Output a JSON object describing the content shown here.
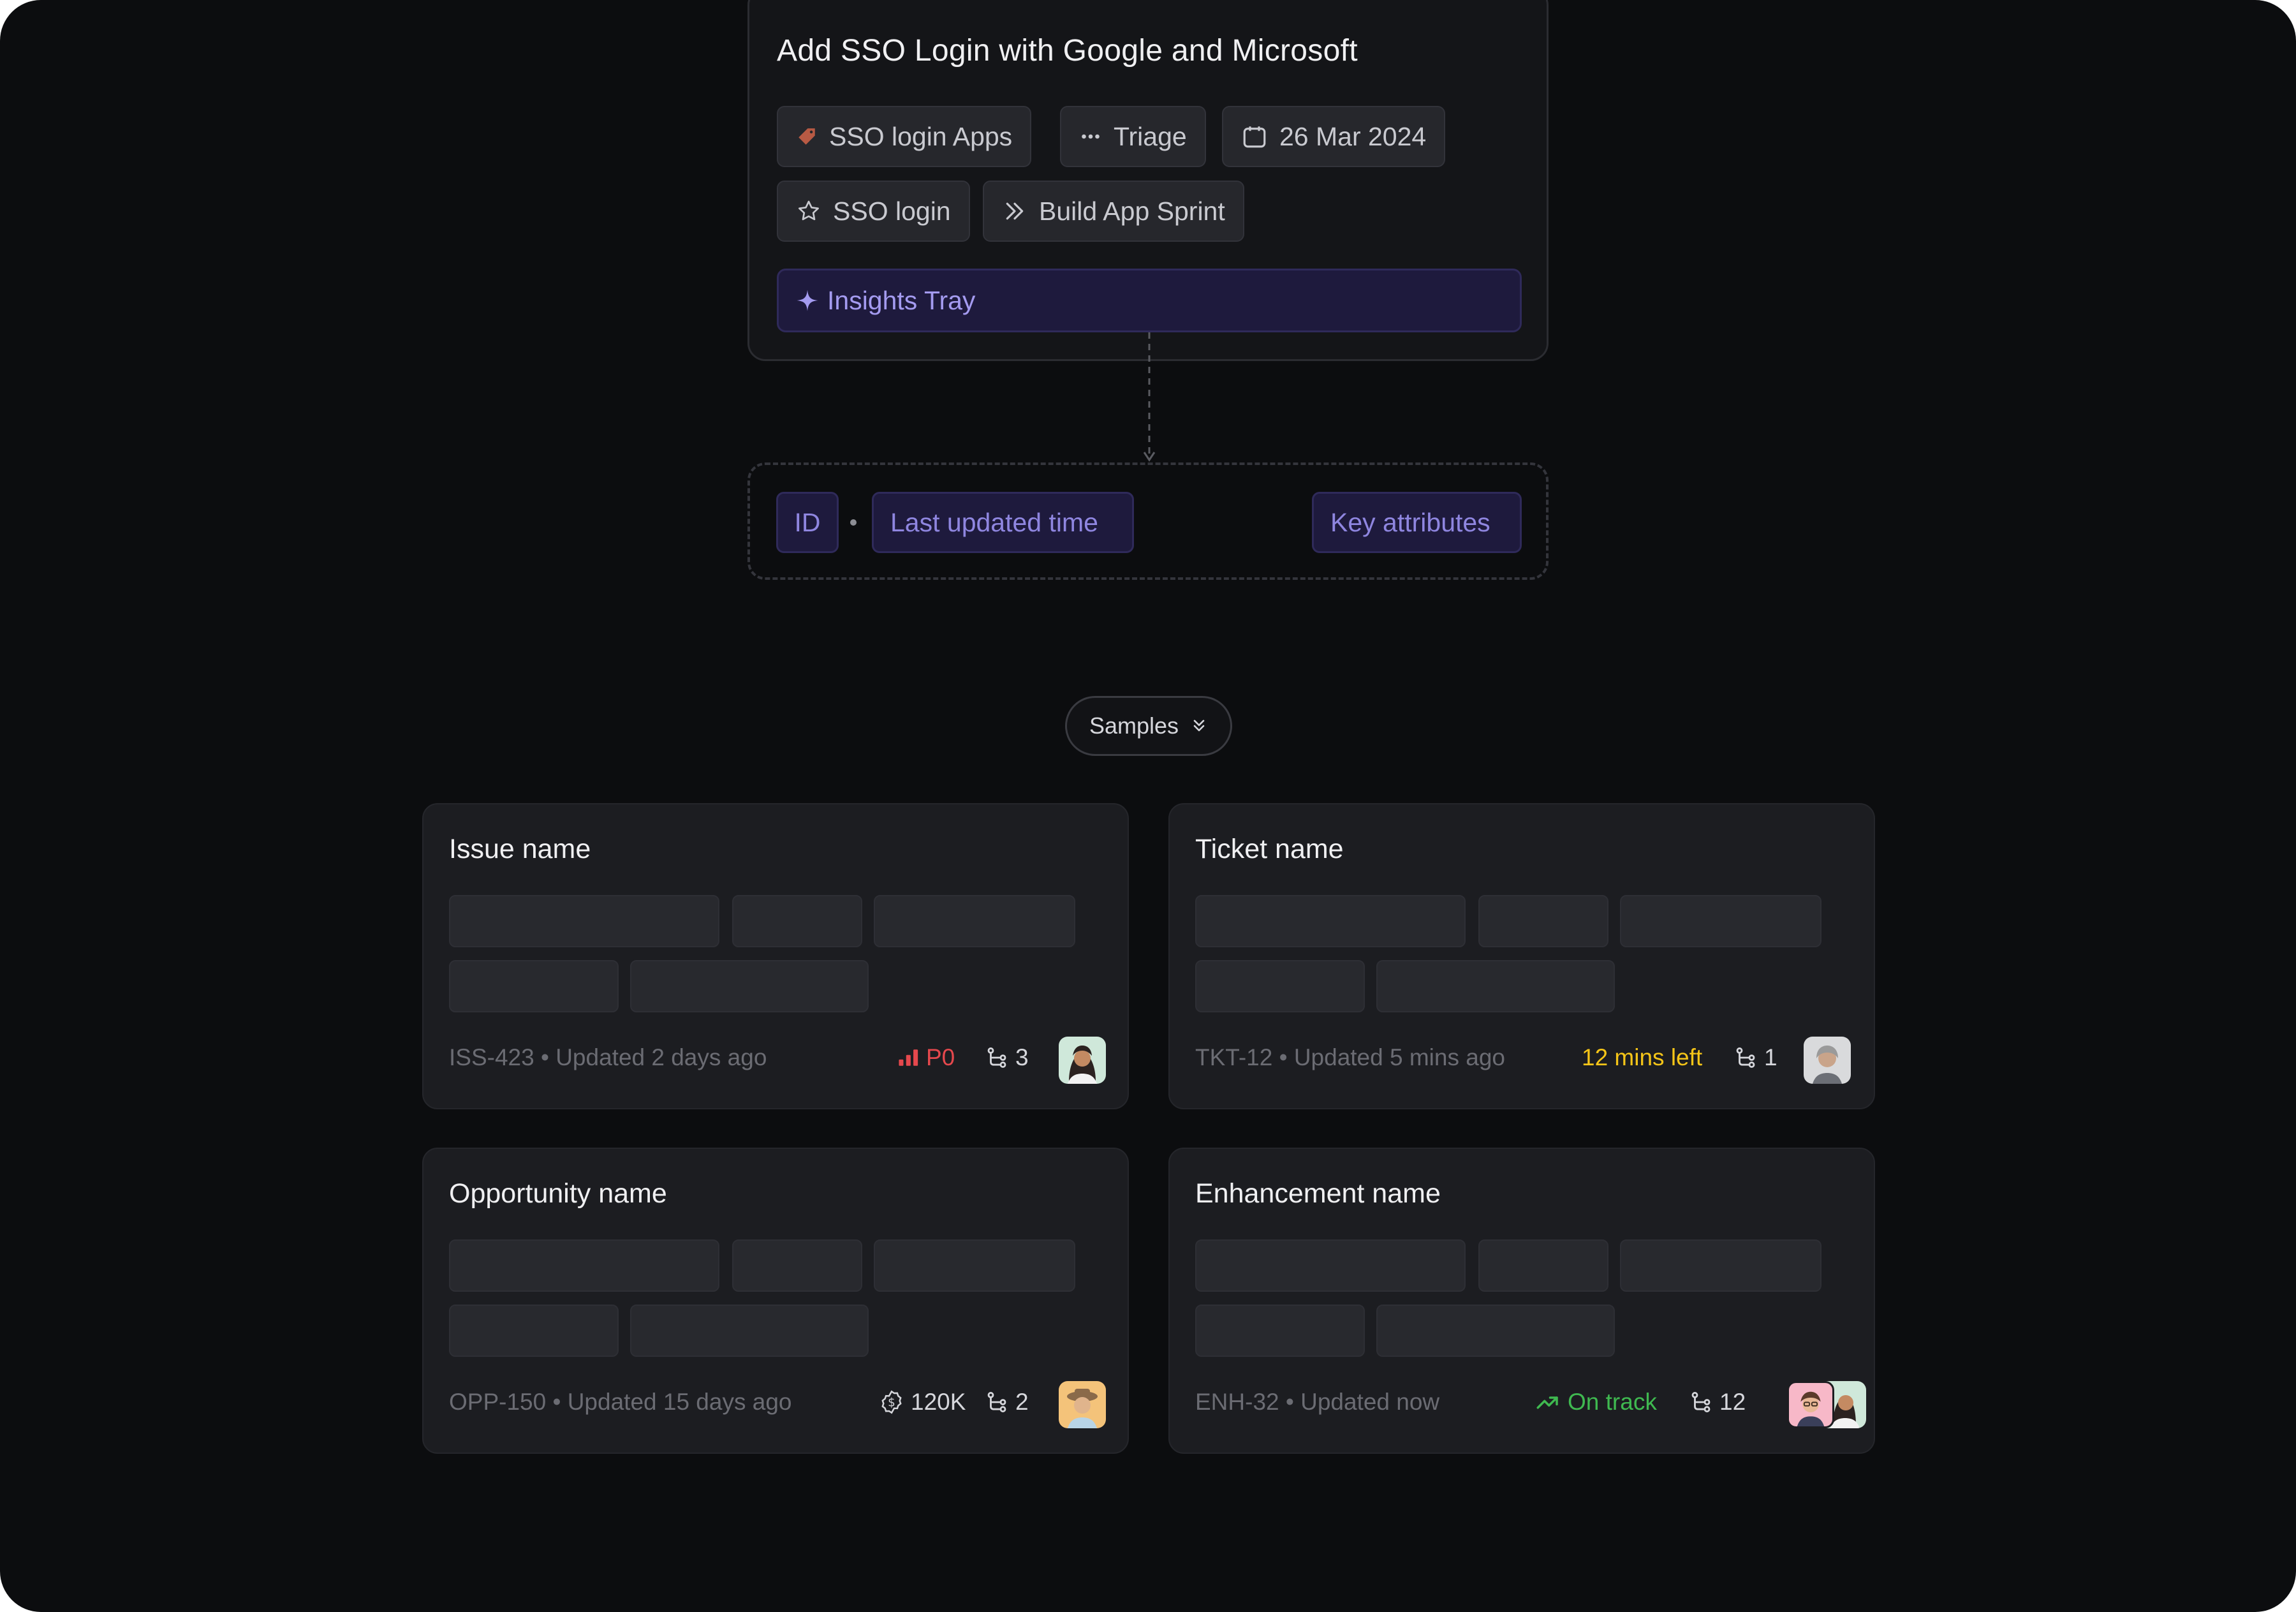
{
  "top_card": {
    "title": "Add SSO Login with Google and Microsoft",
    "chips": [
      {
        "label": "SSO login Apps",
        "icon": "tag-icon"
      },
      {
        "label": "Triage",
        "icon": "more-dots-icon"
      },
      {
        "label": "26 Mar 2024",
        "icon": "calendar-icon"
      },
      {
        "label": "SSO login",
        "icon": "star-icon"
      },
      {
        "label": "Build App Sprint",
        "icon": "double-chevron-right-icon"
      }
    ],
    "insights_label": "Insights Tray",
    "insights_icon": "sparkle-icon"
  },
  "template": {
    "id_label": "ID",
    "time_label": "Last updated time",
    "attributes_label": "Key attributes"
  },
  "samples_label": "Samples",
  "samples_icon": "double-chevron-down-icon",
  "cards": [
    {
      "title": "Issue name",
      "meta": "ISS-423 • Updated 2 days ago",
      "status": "P0",
      "status_color": "#e5484d",
      "status_icon": "priority-bars-icon",
      "links": "3"
    },
    {
      "title": "Ticket name",
      "meta": "TKT-12 • Updated 5 mins ago",
      "status": "12 mins left",
      "status_color": "#f5c518",
      "links": "1"
    },
    {
      "title": "Opportunity name",
      "meta": "OPP-150 • Updated 15 days ago",
      "status": "120K",
      "status_color": "#d6d7dc",
      "status_icon": "dollar-coin-icon",
      "links": "2"
    },
    {
      "title": "Enhancement name",
      "meta": "ENH-32 • Updated now",
      "status": "On track",
      "status_color": "#3fb950",
      "status_icon": "trending-up-icon",
      "links": "12"
    }
  ],
  "colors": {
    "background": "#0c0d0f",
    "accent": "#a49bf0",
    "card": "#1c1d21"
  }
}
